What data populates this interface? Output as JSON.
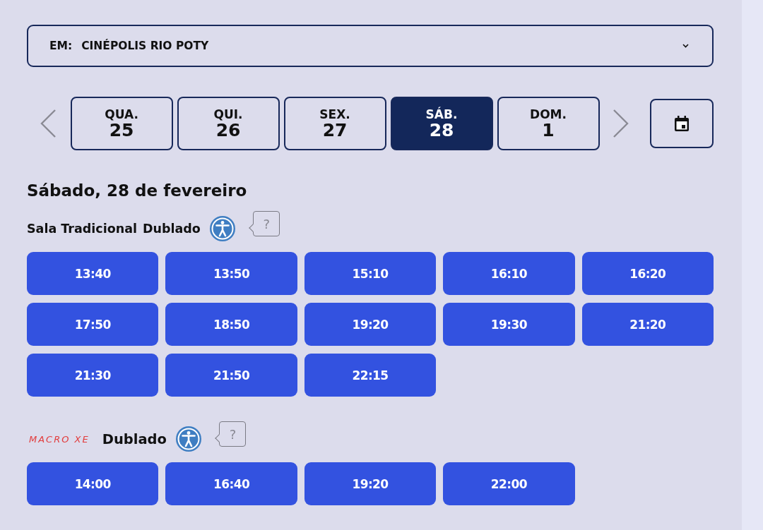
{
  "theater_select": {
    "prefix": "EM:",
    "value": "CINÉPOLIS RIO POTY"
  },
  "date_tabs": [
    {
      "weekday": "QUA.",
      "day": "25",
      "selected": false
    },
    {
      "weekday": "QUI.",
      "day": "26",
      "selected": false
    },
    {
      "weekday": "SEX.",
      "day": "27",
      "selected": false
    },
    {
      "weekday": "SÁB.",
      "day": "28",
      "selected": true
    },
    {
      "weekday": "DOM.",
      "day": "1",
      "selected": false
    }
  ],
  "date_heading": "Sábado, 28 de fevereiro",
  "sessions": [
    {
      "kind": "text",
      "room": "Sala Tradicional",
      "language": "Dublado",
      "accessible": true,
      "help": "?",
      "times": [
        "13:40",
        "13:50",
        "15:10",
        "16:10",
        "16:20",
        "17:50",
        "18:50",
        "19:20",
        "19:30",
        "21:20",
        "21:30",
        "21:50",
        "22:15"
      ]
    },
    {
      "kind": "logo",
      "room": "MACRO XE",
      "language": "Dublado",
      "accessible": true,
      "help": "?",
      "times": [
        "14:00",
        "16:40",
        "19:20",
        "22:00"
      ]
    }
  ]
}
